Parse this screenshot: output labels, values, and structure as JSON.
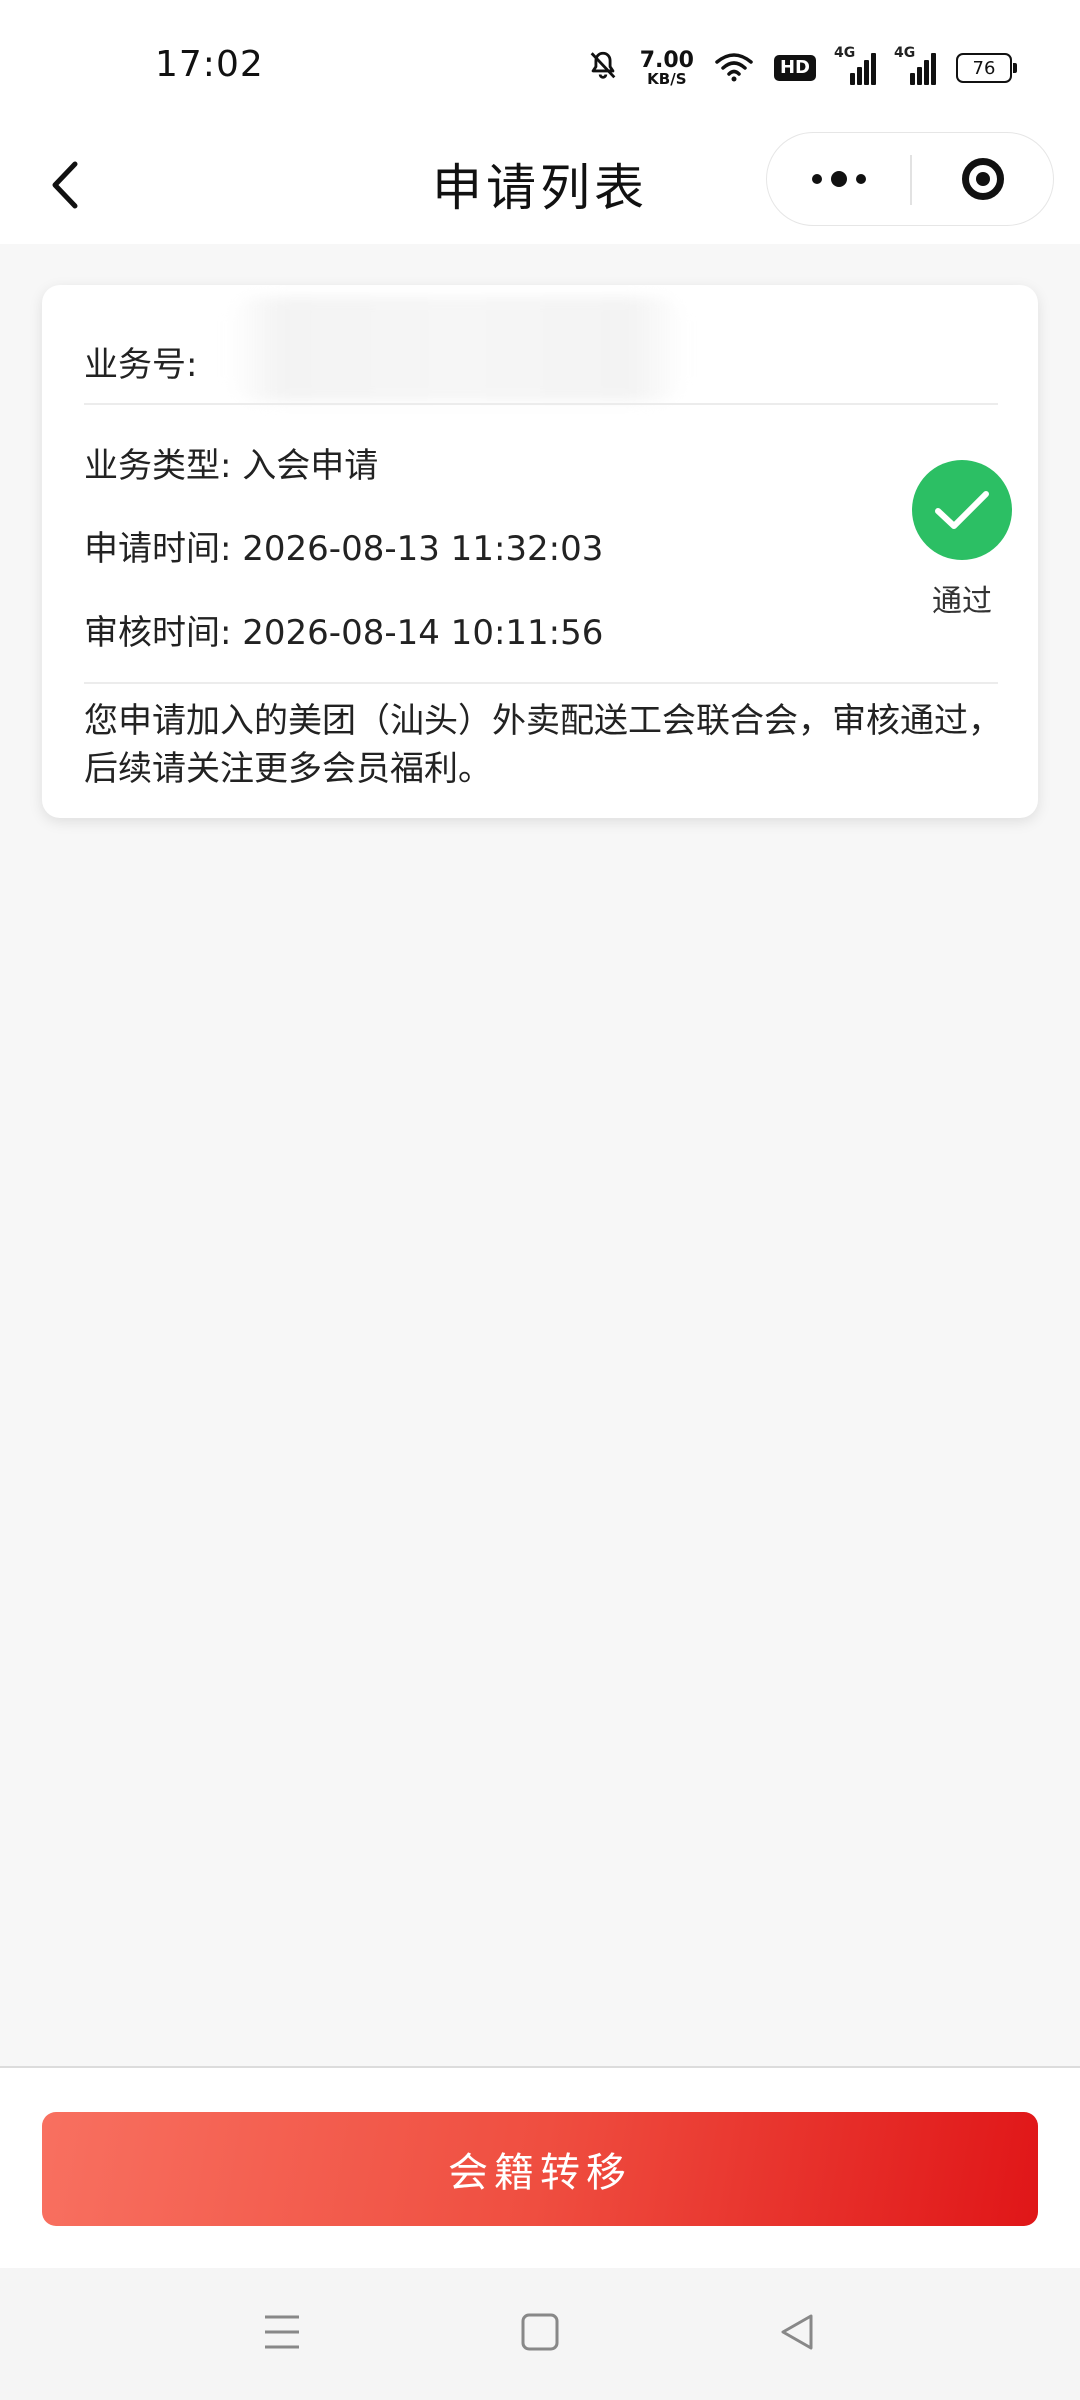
{
  "status_bar": {
    "time": "17:02",
    "net_speed_value": "7.00",
    "net_speed_unit": "KB/S",
    "hd_label": "HD",
    "signal_1": "4G",
    "signal_2": "4G",
    "battery": "76",
    "icons": [
      "bell-off-icon",
      "wifi-icon",
      "signal-icon",
      "battery-icon"
    ]
  },
  "header": {
    "title": "申请列表"
  },
  "record": {
    "business_no_label": "业务号:",
    "business_no_value": "",
    "type_label": "业务类型:",
    "type_value": "入会申请",
    "apply_time_label": "申请时间:",
    "apply_time_value": "2026-08-13 11:32:03",
    "review_time_label": "审核时间:",
    "review_time_value": "2026-08-14 10:11:56",
    "status": "通过",
    "message": "您申请加入的美团（汕头）外卖配送工会联合会，审核通过，后续请关注更多会员福利。"
  },
  "action": {
    "transfer_label": "会籍转移"
  },
  "colors": {
    "success": "#2cbf64",
    "button_start": "#f87060",
    "button_end": "#e01618",
    "page_bg": "#f7f7f7"
  }
}
